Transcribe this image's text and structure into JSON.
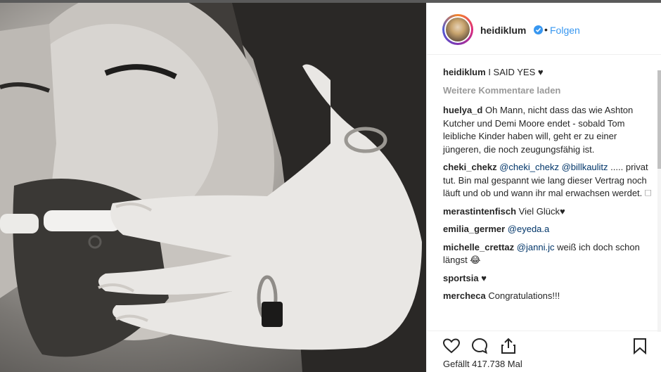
{
  "post": {
    "username": "heidiklum",
    "follow_label": "Folgen",
    "dot": "•",
    "caption_user": "heidiklum",
    "caption_text": "I SAID YES ♥",
    "load_more": "Weitere Kommentare laden",
    "likes": "Gefällt 417.738 Mal"
  },
  "comments": [
    {
      "user": "huelya_d",
      "text": "Oh Mann, nicht dass das wie Ashton Kutcher und Demi Moore endet - sobald Tom leibliche Kinder haben will, geht er zu einer jüngeren, die noch zeugungsfähig ist."
    },
    {
      "user": "cheki_chekz",
      "mention1": "@cheki_chekz",
      "mention2": "@billkaulitz",
      "text": " ..... privat tut. Bin mal gespannt wie lang dieser Vertrag noch läuft und ob und wann ihr mal erwachsen werdet. 🗆"
    },
    {
      "user": "merastintenfisch",
      "text": "Viel Glück♥"
    },
    {
      "user": "emilia_germer",
      "mention1": "@eyeda.a"
    },
    {
      "user": "michelle_crettaz",
      "mention1": "@janni.jc",
      "text": " weiß ich doch schon längst 😂"
    },
    {
      "user": "sportsia",
      "text": "♥"
    },
    {
      "user": "mercheca",
      "text": "Congratulations!!!"
    }
  ],
  "icons": {
    "like": "heart-outline-icon",
    "comment": "speech-bubble-icon",
    "share": "share-arrow-icon",
    "save": "bookmark-icon",
    "verified": "verified-badge-icon"
  },
  "colors": {
    "link_blue": "#3897f0",
    "mention_blue": "#003569",
    "muted_gray": "#999999"
  }
}
